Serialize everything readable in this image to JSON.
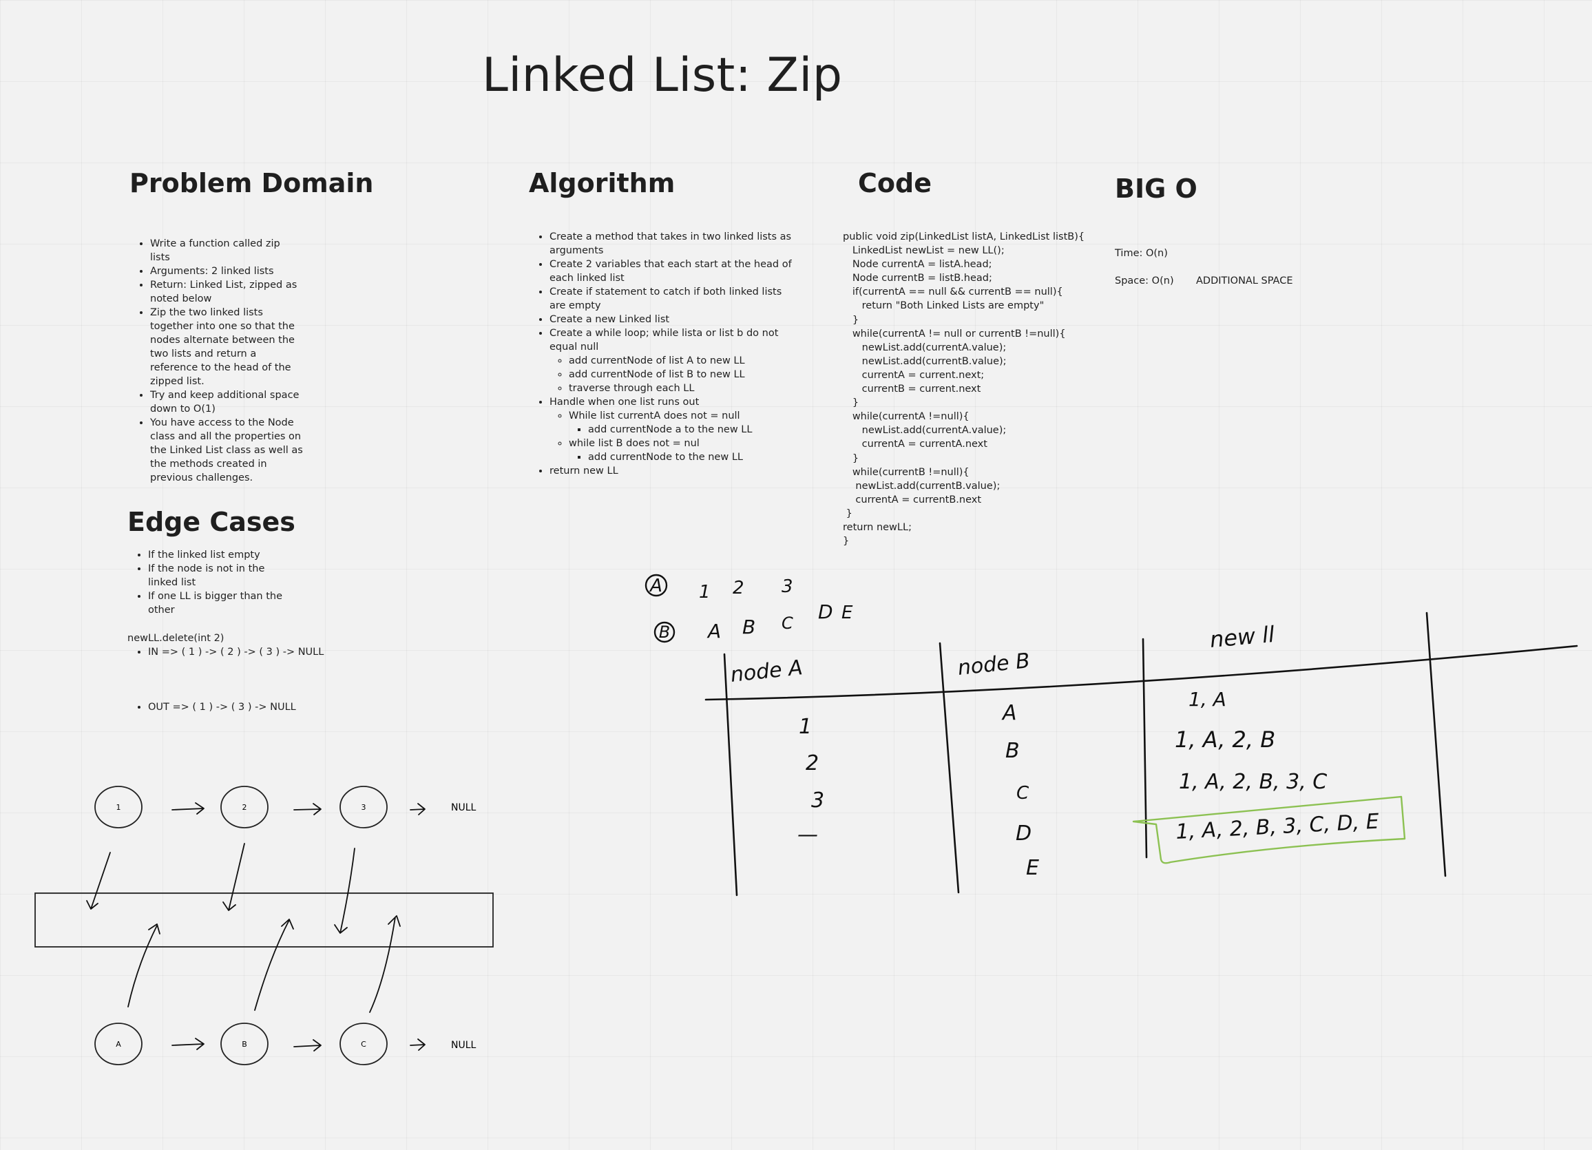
{
  "title": "Linked List: Zip",
  "problem_domain": {
    "heading": "Problem Domain",
    "items": [
      "Write a function called zip lists",
      "Arguments: 2 linked lists",
      "Return: Linked List, zipped as noted below",
      "Zip the two linked lists together into one so that the nodes alternate between the two lists and return a reference to the head of the zipped list.",
      "Try and keep additional space down to O(1)",
      "You have access to the Node class and all the properties on the Linked List class as well as the methods created in previous challenges."
    ]
  },
  "algorithm": {
    "heading": "Algorithm",
    "items": [
      "Create a method that takes in two linked lists as arguments",
      "Create 2 variables that each start at the head of each linked list",
      "Create if statement to catch if both linked lists are empty",
      "Create a new Linked list",
      "Create a while loop; while lista or list b do not equal null",
      "add currentNode of list A to new LL",
      "add currentNode of list B to new LL",
      "traverse through each LL",
      "Handle when one list runs out",
      "While list currentA does not = null",
      "add currentNode a to the new LL",
      "while list B does not = nul",
      "add currentNode to the new LL",
      "return new LL"
    ]
  },
  "code": {
    "heading": "Code",
    "lines": [
      "public void zip(LinkedList listA, LinkedList listB){",
      "   LinkedList newList = new LL();",
      "   Node currentA = listA.head;",
      "   Node currentB = listB.head;",
      "   if(currentA == null && currentB == null){",
      "      return \"Both Linked Lists are empty\"",
      "   }",
      "   while(currentA != null or currentB !=null){",
      "      newList.add(currentA.value);",
      "      newList.add(currentB.value);",
      "      currentA = current.next;",
      "      currentB = current.next",
      "   }",
      "   while(currentA !=null){",
      "      newList.add(currentA.value);",
      "      currentA = currentA.next",
      "   }",
      "   while(currentB !=null){",
      "    newList.add(currentB.value);",
      "    currentA = currentB.next",
      " }",
      "return newLL;",
      "}"
    ]
  },
  "big_o": {
    "heading": "BIG O",
    "time": "Time: O(n)",
    "space": "Space: O(n)",
    "space_note": "ADDITIONAL SPACE"
  },
  "edge_cases": {
    "heading": "Edge Cases",
    "items": [
      "If the linked list empty",
      "If the node is not in the linked list",
      "If one LL is bigger than the other"
    ],
    "example_call": "newLL.delete(int 2)",
    "in_line": "IN => ( 1 ) -> ( 2 ) -> ( 3 ) -> NULL",
    "out_line": "OUT => ( 1 ) -> ( 3 ) -> NULL"
  },
  "diagram": {
    "list_a_nodes": [
      "1",
      "2",
      "3"
    ],
    "list_b_nodes": [
      "A",
      "B",
      "C"
    ],
    "null_label": "NULL"
  },
  "sketch": {
    "list_a_label": "A",
    "list_a_values": [
      "1",
      "2",
      "3"
    ],
    "list_b_label": "B",
    "list_b_values": [
      "A",
      "B",
      "C",
      "D",
      "E"
    ],
    "columns": [
      "node A",
      "node B",
      "new ll"
    ],
    "node_a_values": [
      "1",
      "2",
      "3",
      "—"
    ],
    "node_b_values": [
      "A",
      "B",
      "C",
      "D",
      "E"
    ],
    "new_ll_rows": [
      "1, A",
      "1, A, 2, B",
      "1, A, 2, B, 3, C",
      "1, A, 2, B, 3, C, D, E"
    ],
    "highlight_color": "#8cc152"
  }
}
